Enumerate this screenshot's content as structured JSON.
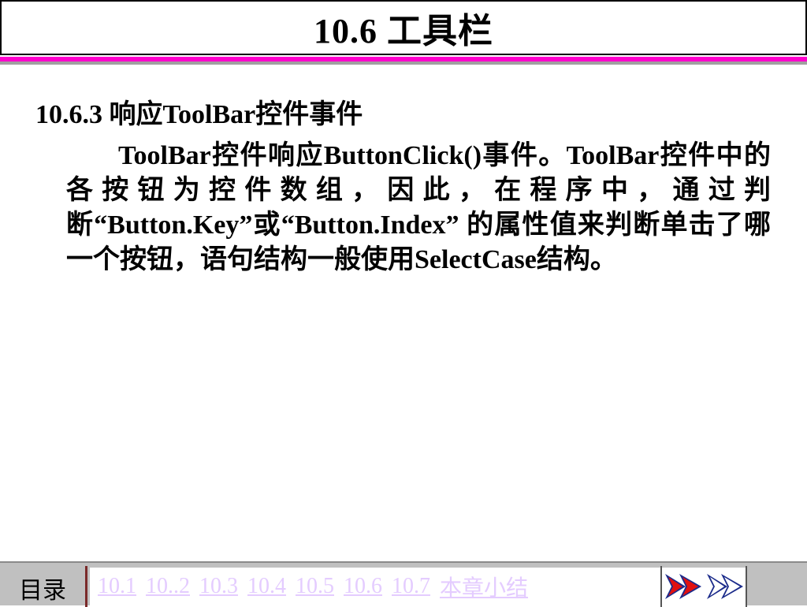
{
  "slide": {
    "title": "10.6  工具栏",
    "section_heading": "10.6.3   响应ToolBar控件事件",
    "body": "ToolBar控件响应ButtonClick()事件。ToolBar控件中的各按钮为控件数组，因此，在程序中，通过判断“Button.Key”或“Button.Index” 的属性值来判断单击了哪一个按钮，语句结构一般使用SelectCase结构。"
  },
  "footer": {
    "toc_label": "目录",
    "links": [
      "10.1",
      "10..2",
      "10.3",
      "10.4",
      "10.5",
      "10.6",
      "10.7",
      "本章小结"
    ],
    "link_color": "#e4ccff",
    "nav": [
      {
        "name": "prev-arrow-icon",
        "icon": "double-chevron-right-icon"
      },
      {
        "name": "next-arrow-icon",
        "icon": "double-chevron-right-icon"
      }
    ]
  },
  "colors": {
    "title_rule": "#ff00cc",
    "footer_bg": "#c0c0c0"
  }
}
